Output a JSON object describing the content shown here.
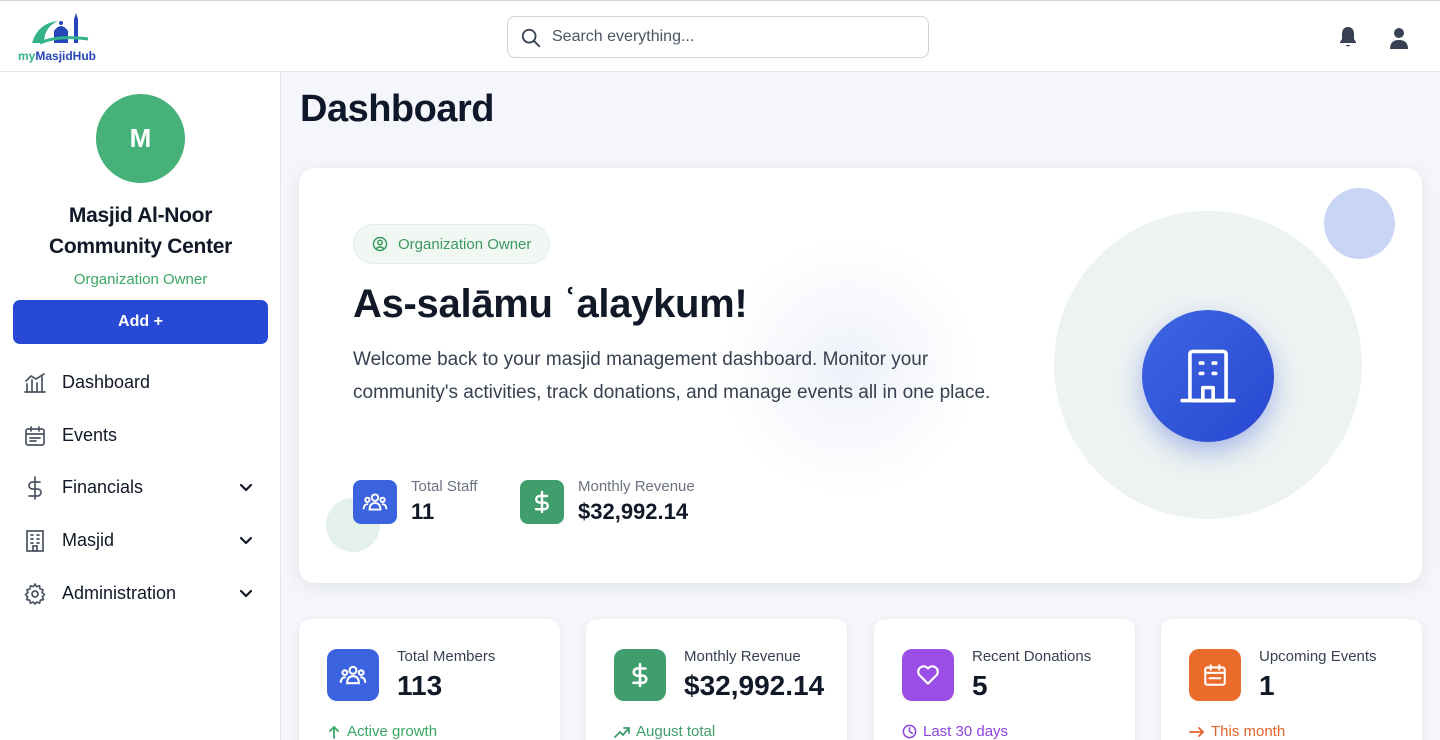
{
  "header": {
    "logo": {
      "prefix": "my",
      "name": "MasjidHub"
    },
    "search": {
      "placeholder": "Search everything..."
    }
  },
  "sidebar": {
    "avatar_initial": "M",
    "org_name_line1": "Masjid Al-Noor",
    "org_name_line2": "Community Center",
    "org_role": "Organization Owner",
    "add_label": "Add +",
    "items": [
      {
        "label": "Dashboard",
        "icon": "chart-icon",
        "expandable": false
      },
      {
        "label": "Events",
        "icon": "calendar-icon",
        "expandable": false
      },
      {
        "label": "Financials",
        "icon": "dollar-icon",
        "expandable": true
      },
      {
        "label": "Masjid",
        "icon": "building-icon",
        "expandable": true
      },
      {
        "label": "Administration",
        "icon": "gear-icon",
        "expandable": true
      }
    ]
  },
  "main": {
    "title": "Dashboard",
    "hero": {
      "role_chip": "Organization Owner",
      "greeting": "As-salāmu ʿalaykum!",
      "description": "Welcome back to your masjid management dashboard. Monitor your community's activities, track donations, and manage events all in one place.",
      "stats": [
        {
          "label": "Total Staff",
          "value": "11",
          "icon": "users-icon",
          "color": "#3b63e0"
        },
        {
          "label": "Monthly Revenue",
          "value": "$32,992.14",
          "icon": "dollar-icon",
          "color": "#3f9e6b"
        }
      ]
    },
    "cards": [
      {
        "label": "Total Members",
        "value": "113",
        "footer": "Active growth",
        "icon": "users-icon",
        "color": "#3b63e0",
        "footer_color": "#3aa862"
      },
      {
        "label": "Monthly Revenue",
        "value": "$32,992.14",
        "footer": "August total",
        "icon": "dollar-icon",
        "color": "#3f9e6b",
        "footer_color": "#3f9e6b"
      },
      {
        "label": "Recent Donations",
        "value": "5",
        "footer": "Last 30 days",
        "icon": "heart-icon",
        "color": "#9b4ee6",
        "footer_color": "#8b45dd"
      },
      {
        "label": "Upcoming Events",
        "value": "1",
        "footer": "This month",
        "icon": "calendar-icon",
        "color": "#ea6b2a",
        "footer_color": "#e4632a"
      }
    ]
  }
}
